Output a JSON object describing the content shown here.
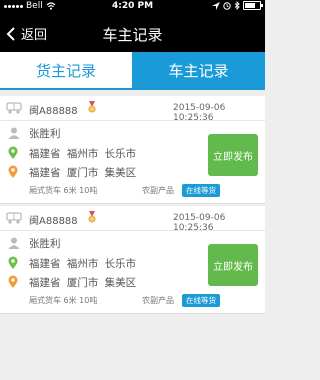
{
  "status_bar": {
    "carrier": "Bell",
    "time": "4:20 PM"
  },
  "nav": {
    "back_label": "返回",
    "title": "车主记录"
  },
  "tabs": [
    {
      "label": "货主记录",
      "active": false
    },
    {
      "label": "车主记录",
      "active": true
    }
  ],
  "records": [
    {
      "plate": "闽A88888",
      "time": "2015-09-06  10:25:36",
      "name": "张胜利",
      "from": "福建省 福州市 长乐市",
      "to": "福建省 厦门市 集美区",
      "meta": "厢式货车  6米  10吨",
      "cargo": "农副产品",
      "status": "在线等货",
      "action_label": "立即发布"
    },
    {
      "plate": "闽A88888",
      "time": "2015-09-06  10:25:36",
      "name": "张胜利",
      "from": "福建省 福州市 长乐市",
      "to": "福建省 厦门市 集美区",
      "meta": "厢式货车  6米  10吨",
      "cargo": "农副产品",
      "status": "在线等货",
      "action_label": "立即发布"
    }
  ],
  "colors": {
    "accent": "#1a9ad6",
    "action": "#62b94c",
    "pin_from": "#6cc04a",
    "pin_to": "#f39c3a"
  },
  "icons": [
    "signal-icon",
    "wifi-icon",
    "location-arrow-icon",
    "alarm-icon",
    "bluetooth-icon",
    "battery-icon",
    "back-chevron-icon",
    "truck-icon",
    "medal-icon",
    "person-icon",
    "location-pin-icon"
  ]
}
